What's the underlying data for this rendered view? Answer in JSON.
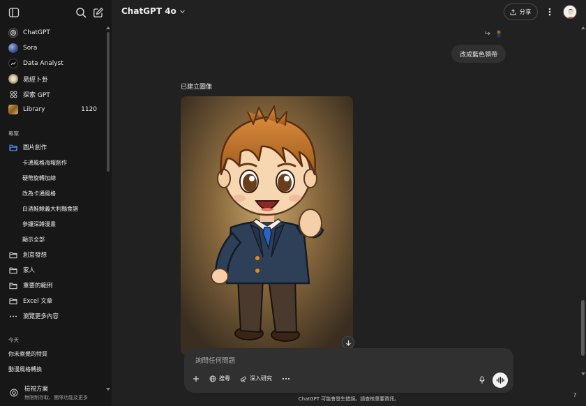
{
  "sidebar": {
    "gpts": [
      {
        "label": "ChatGPT",
        "icon": "openai-icon"
      },
      {
        "label": "Sora",
        "icon": "sora-icon"
      },
      {
        "label": "Data Analyst",
        "icon": "data-analyst-icon"
      },
      {
        "label": "易經卜卦",
        "icon": "iching-icon"
      },
      {
        "label": "探索 GPT",
        "icon": "grid-icon"
      },
      {
        "label": "Library",
        "icon": "library-icon",
        "count": "1120"
      }
    ],
    "projects_label": "專案",
    "projects": [
      {
        "label": "圖片創作",
        "open": true
      },
      {
        "label": "創意發想"
      },
      {
        "label": "家人"
      },
      {
        "label": "重要的範例"
      },
      {
        "label": "Excel 文章"
      }
    ],
    "project_chats": [
      "卡通風格海報創作",
      "硬幣旋轉加總",
      "改為卡通風格",
      "白酒鮭鰍義大利麵食譜",
      "參鑼深蹲漫畫",
      "顯示全部"
    ],
    "more_label": "瀏覽更多內容",
    "today_label": "今天",
    "today_chats": [
      "你未察覺的特質",
      "動漫風格轉換"
    ],
    "upgrade": {
      "title": "檢視方案",
      "subtitle": "無限制存取、團隊功能及更多"
    }
  },
  "header": {
    "model": "ChatGPT 4o",
    "share_label": "分享"
  },
  "chat": {
    "user_message": "改成藍色領帶",
    "assistant_label": "已建立圖像",
    "image_alt": "cartoon boy in navy suit with blue tie"
  },
  "composer": {
    "placeholder": "詢問任何問題",
    "search_label": "搜尋",
    "research_label": "深入研究"
  },
  "footer": {
    "disclaimer": "ChatGPT 可能會發生錯誤。請查核重要資訊。",
    "help": "?"
  },
  "colors": {
    "sidebar_bg": "#171717",
    "main_bg": "#212121",
    "bubble_bg": "#303030",
    "folder_accent": "#4a8cff"
  }
}
